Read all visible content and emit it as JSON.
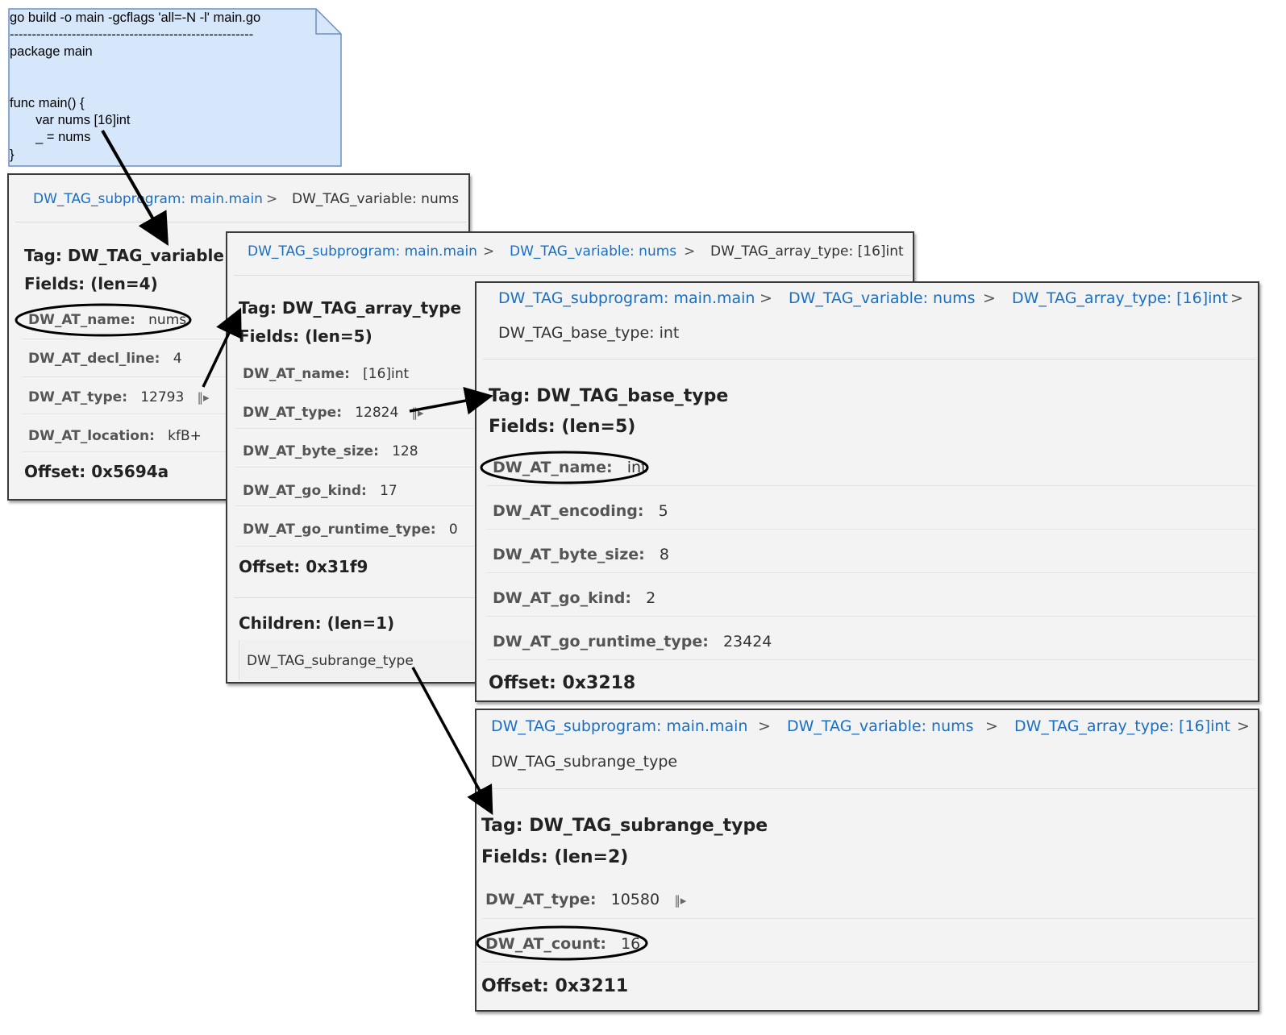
{
  "note": {
    "lines": [
      "go build -o main -gcflags 'all=-N -l' main.go",
      "-------------------------------------------------------",
      "package main",
      "",
      "",
      "func main() {",
      "       var nums [16]int",
      "       _ = nums",
      "}"
    ]
  },
  "colors": {
    "link": "#1a6fc4",
    "note_fill": "#d6e6fb",
    "note_stroke": "#6d8ebf"
  },
  "panel1": {
    "crumbs": [
      "DW_TAG_subprogram: main.main"
    ],
    "sep": ">",
    "current": "DW_TAG_variable: nums",
    "tag": "Tag: DW_TAG_variable",
    "fields": "Fields: (len=4)",
    "rows": [
      {
        "k": "DW_AT_name:",
        "v": "nums"
      },
      {
        "k": "DW_AT_decl_line:",
        "v": "4"
      },
      {
        "k": "DW_AT_type:",
        "v": "12793"
      },
      {
        "k": "DW_AT_location:",
        "v": "kfB+"
      }
    ],
    "offset": "Offset: 0x5694a"
  },
  "panel2": {
    "crumbs": [
      "DW_TAG_subprogram: main.main",
      "DW_TAG_variable: nums"
    ],
    "sep": ">",
    "current": "DW_TAG_array_type: [16]int",
    "tag": "Tag: DW_TAG_array_type",
    "fields": "Fields: (len=5)",
    "rows": [
      {
        "k": "DW_AT_name:",
        "v": "[16]int"
      },
      {
        "k": "DW_AT_type:",
        "v": "12824"
      },
      {
        "k": "DW_AT_byte_size:",
        "v": "128"
      },
      {
        "k": "DW_AT_go_kind:",
        "v": "17"
      },
      {
        "k": "DW_AT_go_runtime_type:",
        "v": "0"
      }
    ],
    "offset": "Offset: 0x31f9",
    "children": "Children: (len=1)",
    "child": "DW_TAG_subrange_type"
  },
  "panel3": {
    "crumbs": [
      "DW_TAG_subprogram: main.main",
      "DW_TAG_variable: nums",
      "DW_TAG_array_type: [16]int"
    ],
    "sep": ">",
    "current": "DW_TAG_base_type: int",
    "tag": "Tag: DW_TAG_base_type",
    "fields": "Fields: (len=5)",
    "rows": [
      {
        "k": "DW_AT_name:",
        "v": "int"
      },
      {
        "k": "DW_AT_encoding:",
        "v": "5"
      },
      {
        "k": "DW_AT_byte_size:",
        "v": "8"
      },
      {
        "k": "DW_AT_go_kind:",
        "v": "2"
      },
      {
        "k": "DW_AT_go_runtime_type:",
        "v": "23424"
      }
    ],
    "offset": "Offset: 0x3218"
  },
  "panel4": {
    "crumbs": [
      "DW_TAG_subprogram: main.main",
      "DW_TAG_variable: nums",
      "DW_TAG_array_type: [16]int"
    ],
    "sep": ">",
    "current": "DW_TAG_subrange_type",
    "tag": "Tag: DW_TAG_subrange_type",
    "fields": "Fields: (len=2)",
    "rows": [
      {
        "k": "DW_AT_type:",
        "v": "10580"
      },
      {
        "k": "DW_AT_count:",
        "v": "16"
      }
    ],
    "offset": "Offset: 0x3211"
  },
  "jump_icon": "jump-to-icon"
}
